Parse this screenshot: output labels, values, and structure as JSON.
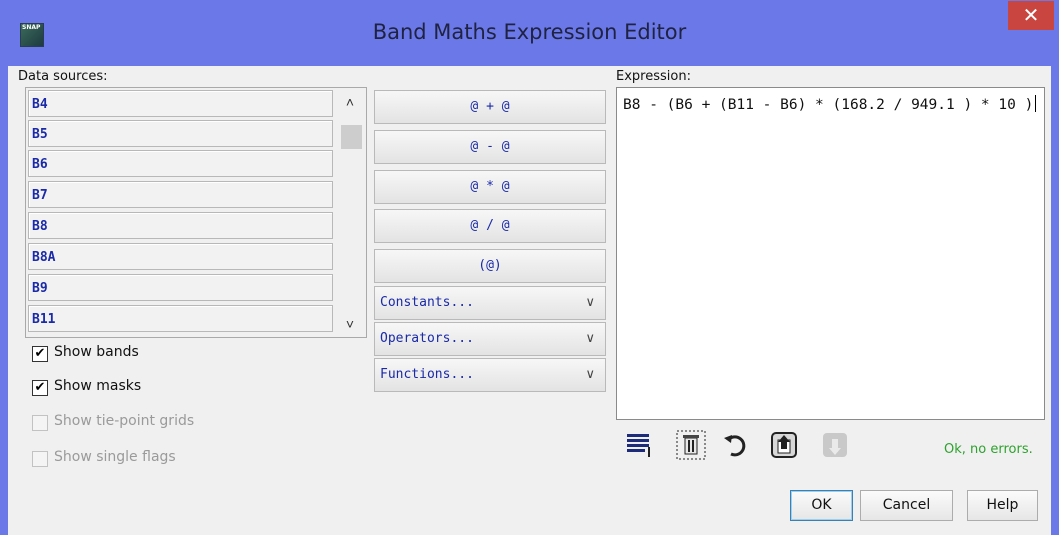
{
  "window": {
    "title": "Band Maths Expression Editor",
    "close_label": "✕",
    "icon_text": "SNAP"
  },
  "data_sources": {
    "label": "Data sources:",
    "items": [
      "B4",
      "B5",
      "B6",
      "B7",
      "B8",
      "B8A",
      "B9",
      "B11"
    ],
    "scroll_up": "˄",
    "scroll_down": "˅"
  },
  "checkboxes": [
    {
      "label": "Show bands",
      "checked": true,
      "mark": "✔",
      "enabled": true
    },
    {
      "label": "Show masks",
      "checked": true,
      "mark": "✔",
      "enabled": true
    },
    {
      "label": "Show tie-point grids",
      "checked": false,
      "mark": "",
      "enabled": false
    },
    {
      "label": "Show single flags",
      "checked": false,
      "mark": "",
      "enabled": false
    }
  ],
  "operator_buttons": [
    "@ + @",
    "@ - @",
    "@ * @",
    "@ / @",
    "(@)"
  ],
  "dropdowns": [
    {
      "label": "Constants...",
      "chevron": "∨"
    },
    {
      "label": "Operators...",
      "chevron": "∨"
    },
    {
      "label": "Functions...",
      "chevron": "∨"
    }
  ],
  "expression": {
    "label": "Expression:",
    "value": "B8 - (B6 + (B11 - B6) * (168.2 / 949.1 ) * 10 )"
  },
  "tools": [
    {
      "name": "edit-expression-icon"
    },
    {
      "name": "clear-expression-icon"
    },
    {
      "name": "undo-icon"
    },
    {
      "name": "import-expression-icon"
    },
    {
      "name": "export-expression-icon"
    }
  ],
  "status": {
    "text": "Ok, no errors.",
    "color": "#2ea12e"
  },
  "buttons": {
    "ok": "OK",
    "cancel": "Cancel",
    "help": "Help"
  },
  "colors": {
    "title_bar": "#6b79e8",
    "close": "#c9453f",
    "band_text": "#1a2aa8"
  }
}
